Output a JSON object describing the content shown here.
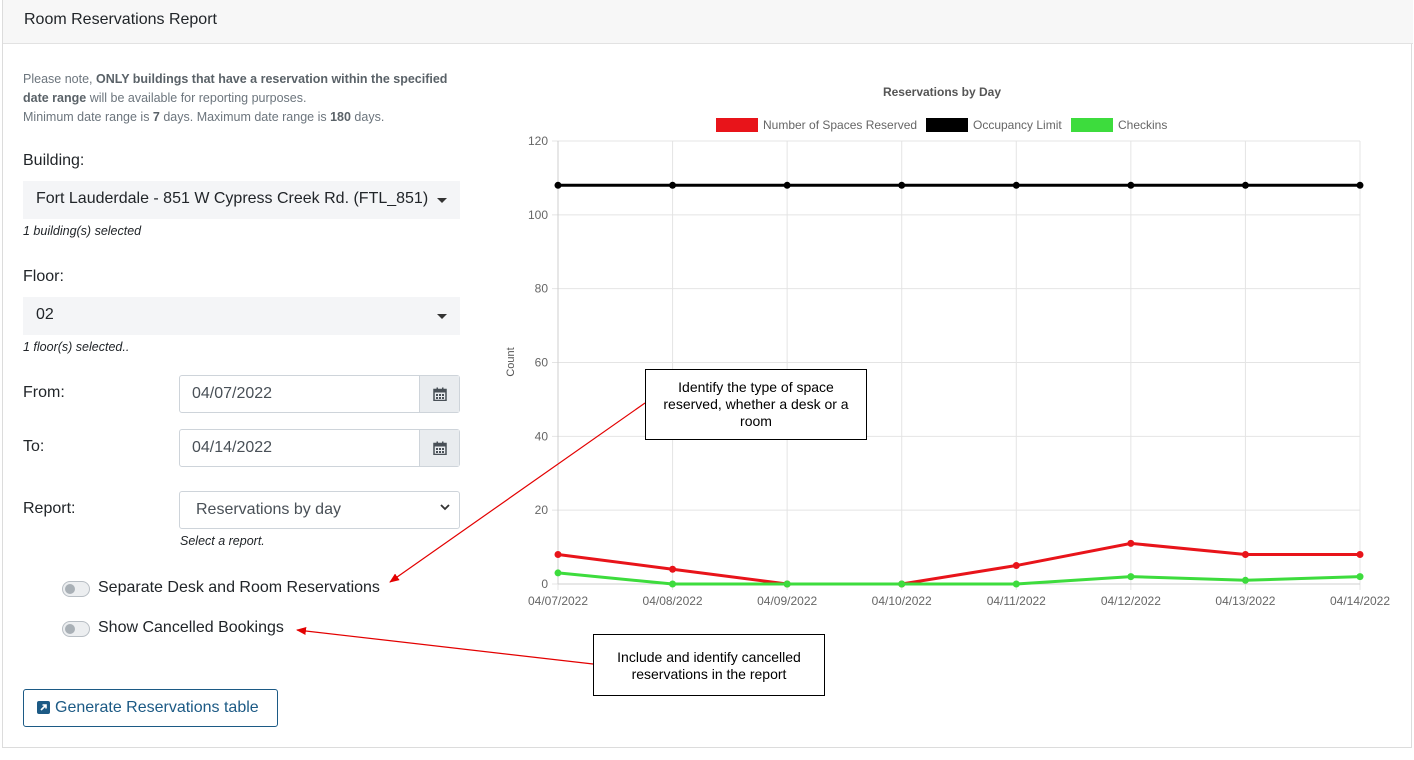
{
  "header": {
    "title": "Room Reservations Report"
  },
  "note": {
    "line1_prefix": "Please note, ",
    "line1_bold": "ONLY buildings that have a reservation within the specified date range",
    "line1_suffix": " will be available for reporting purposes.",
    "line2_prefix": "Minimum date range is ",
    "min_days": "7",
    "line2_mid": " days. Maximum date range is ",
    "max_days": "180",
    "line2_suffix": " days."
  },
  "form": {
    "building_label": "Building:",
    "building_value": "Fort Lauderdale - 851 W Cypress Creek Rd. (FTL_851)",
    "building_help": "1 building(s) selected",
    "floor_label": "Floor:",
    "floor_value": "02",
    "floor_help": "1 floor(s) selected..",
    "from_label": "From:",
    "from_value": "04/07/2022",
    "to_label": "To:",
    "to_value": "04/14/2022",
    "report_label": "Report:",
    "report_value": "Reservations by day",
    "report_help": "Select a report.",
    "toggle_separate_label": "Separate Desk and Room Reservations",
    "toggle_cancelled_label": "Show Cancelled Bookings",
    "generate_button": "Generate Reservations table"
  },
  "callouts": {
    "space_type": "Identify the type of space reserved, whether a desk or a room",
    "cancelled": "Include and identify cancelled reservations in the report"
  },
  "colors": {
    "reserved": "#e8141a",
    "occupancy": "#000000",
    "checkins": "#3ddc3d",
    "annotation_arrow": "#e30000",
    "button_blue": "#1c5a85"
  },
  "chart_data": {
    "type": "line",
    "title": "Reservations by Day",
    "xlabel": "",
    "ylabel": "Count",
    "ylim": [
      0,
      120
    ],
    "yticks": [
      0,
      20,
      40,
      60,
      80,
      100,
      120
    ],
    "grid": true,
    "legend_position": "top",
    "categories": [
      "04/07/2022",
      "04/08/2022",
      "04/09/2022",
      "04/10/2022",
      "04/11/2022",
      "04/12/2022",
      "04/13/2022",
      "04/14/2022"
    ],
    "series": [
      {
        "name": "Number of Spaces Reserved",
        "color": "#e8141a",
        "values": [
          8,
          4,
          0,
          0,
          5,
          11,
          8,
          8
        ]
      },
      {
        "name": "Occupancy Limit",
        "color": "#000000",
        "values": [
          108,
          108,
          108,
          108,
          108,
          108,
          108,
          108
        ]
      },
      {
        "name": "Checkins",
        "color": "#3ddc3d",
        "values": [
          3,
          0,
          0,
          0,
          0,
          2,
          1,
          2
        ]
      }
    ]
  }
}
